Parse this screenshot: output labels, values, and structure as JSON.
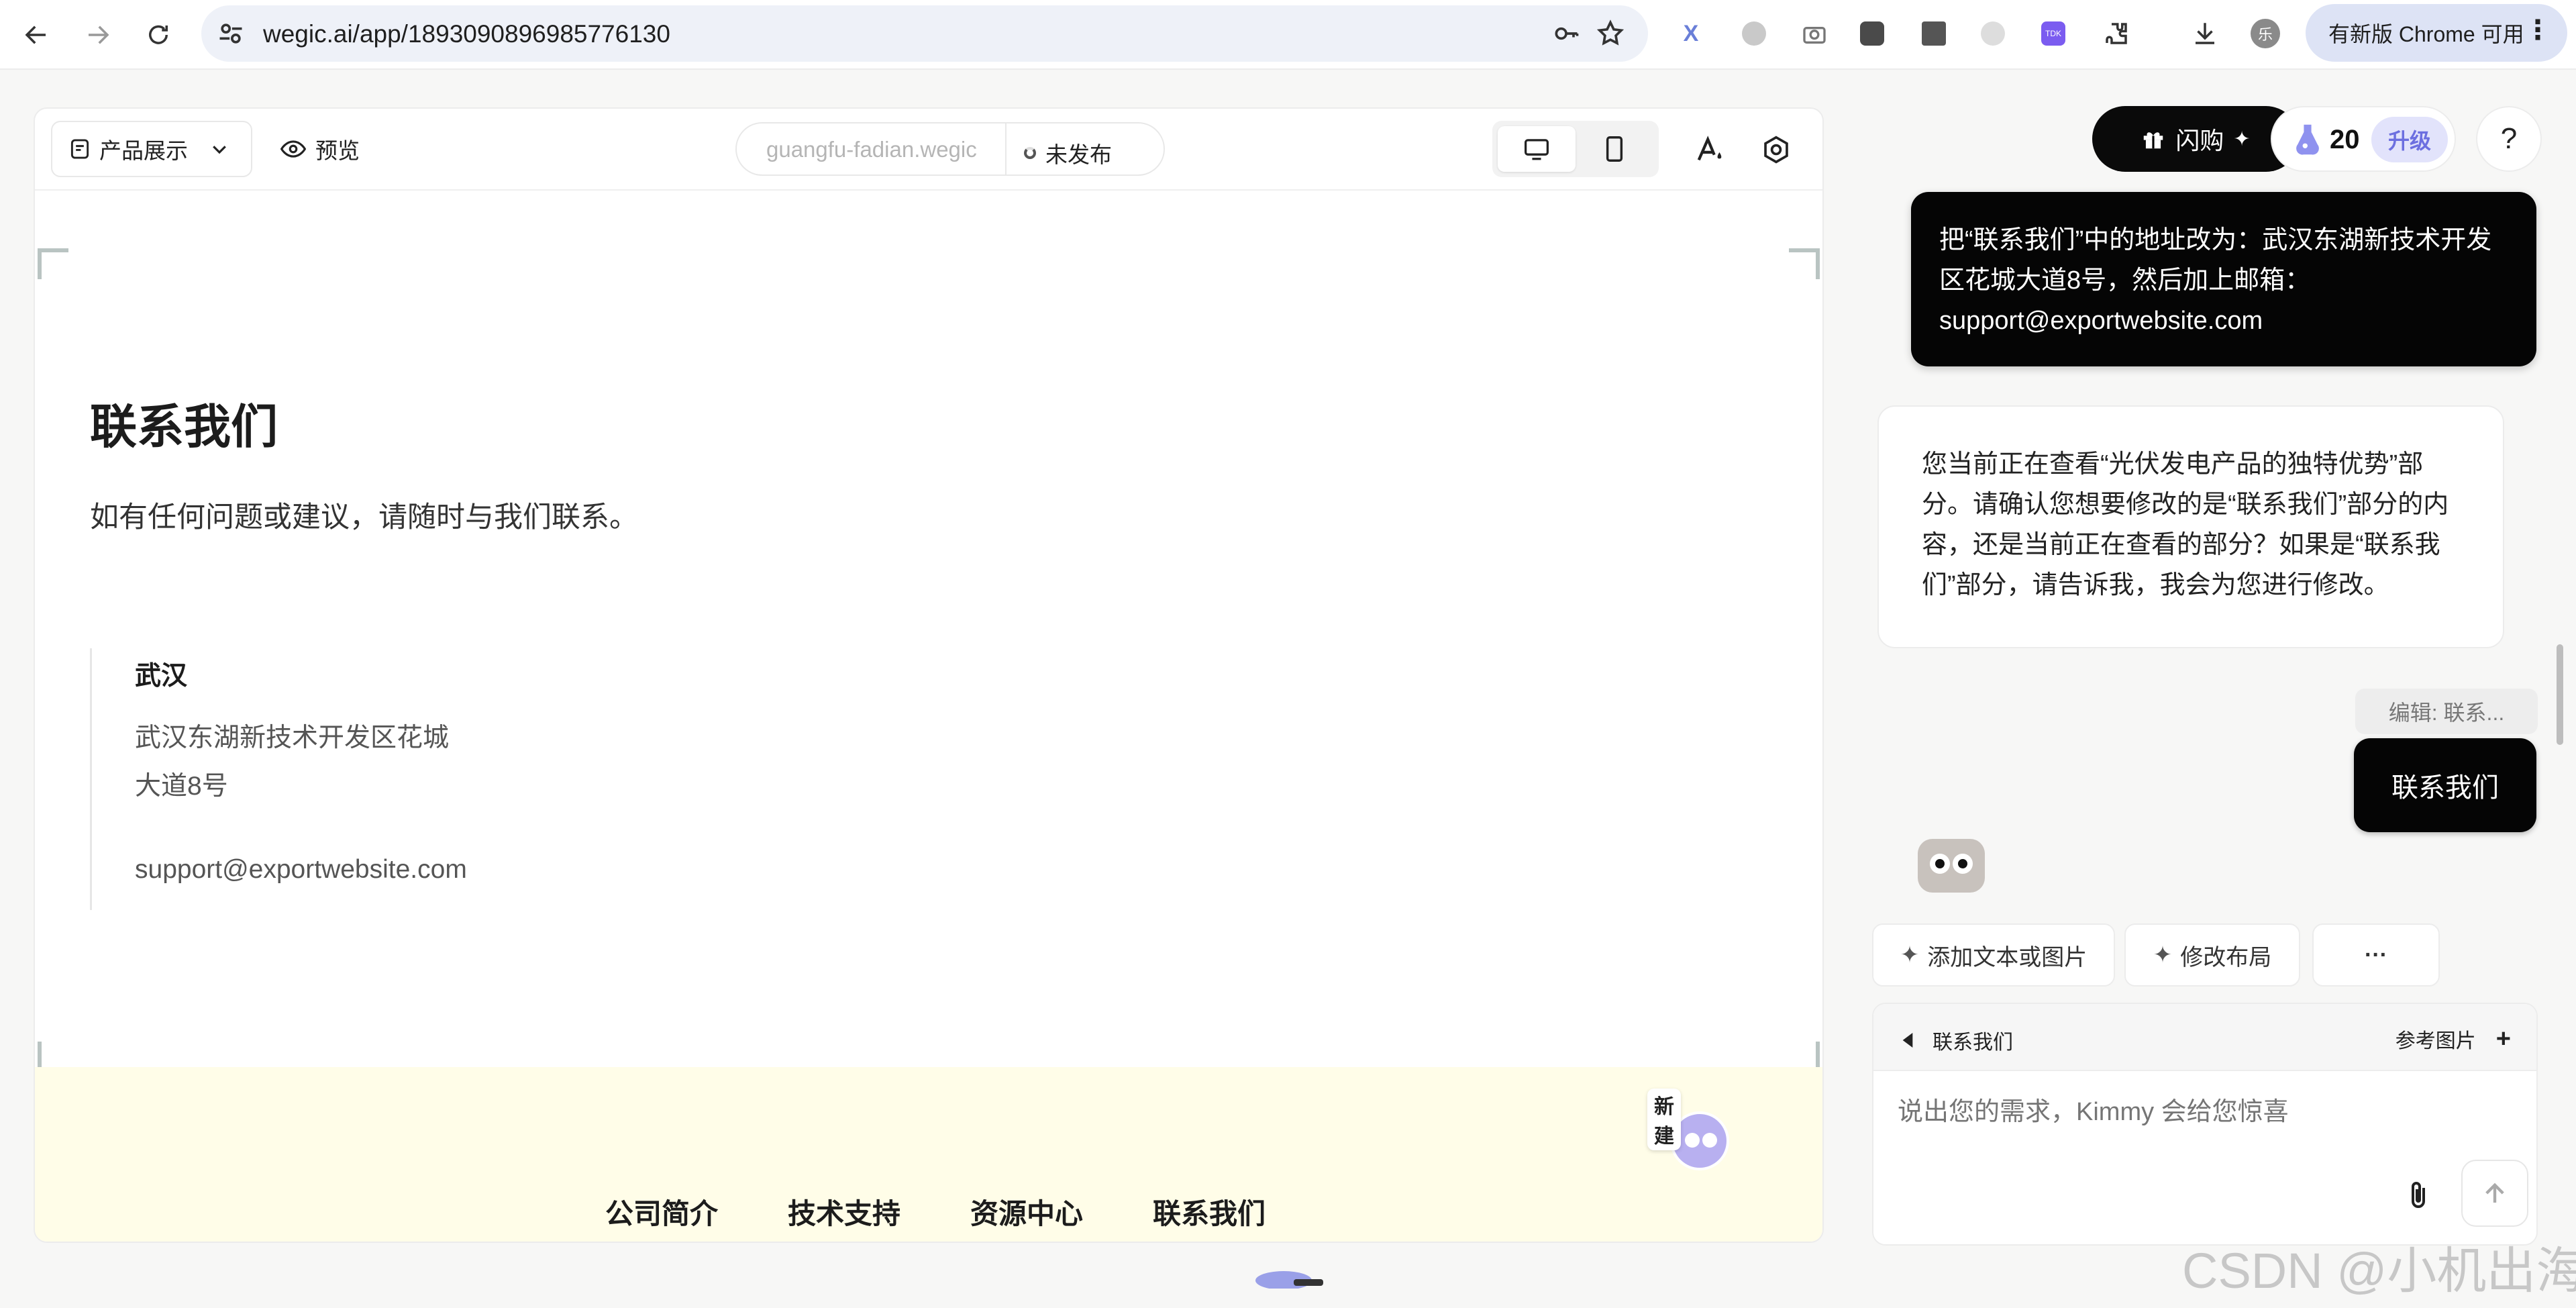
{
  "browser": {
    "url": "wegic.ai/app/1893090896985776130",
    "update_label": "有新版 Chrome 可用",
    "icons": [
      "back-icon",
      "forward-icon",
      "reload-icon",
      "site-settings-icon",
      "password-key-icon",
      "bookmark-star-icon",
      "download-icon",
      "profile-avatar-icon",
      "menu-dots-icon"
    ],
    "profile_initial": "乐",
    "ext_tdk": "TDK"
  },
  "editor": {
    "page_select": "产品展示",
    "preview_label": "预览",
    "domain": "guangfu-fadian.wegic",
    "publish_status": "未发布"
  },
  "page": {
    "title": "联系我们",
    "subtitle": "如有任何问题或建议，请随时与我们联系。",
    "city": "武汉",
    "address_line1": "武汉东湖新技术开发区花城",
    "address_line2": "大道8号",
    "email": "support@exportwebsite.com",
    "footer_links": [
      "公司简介",
      "技术支持",
      "资源中心",
      "联系我们"
    ],
    "new_badge": "新建"
  },
  "panel": {
    "flash_label": "闪购",
    "credits": "20",
    "upgrade_label": "升级",
    "help_label": "?",
    "user_message": "把“联系我们”中的地址改为：武汉东湖新技术开发区花城大道8号，然后加上邮箱：support@exportwebsite.com",
    "ai_message": "您当前正在查看“光伏发电产品的独特优势”部分。请确认您想要修改的是“联系我们”部分的内容，还是当前正在查看的部分？如果是“联系我们”部分，请告诉我，我会为您进行修改。",
    "edit_chip": "编辑: 联系...",
    "contact_chip": "联系我们",
    "actions": [
      "添加文本或图片",
      "修改布局"
    ],
    "more_label": "···",
    "composer_context": "联系我们",
    "reference_image": "参考图片",
    "add_label": "+",
    "input_placeholder": "说出您的需求，Kimmy 会给您惊喜"
  },
  "watermark": "CSDN @小机出海",
  "colors": {
    "accent_purple": "#6c6fe0",
    "footer_bg": "#fffde8",
    "dark": "#050505"
  }
}
